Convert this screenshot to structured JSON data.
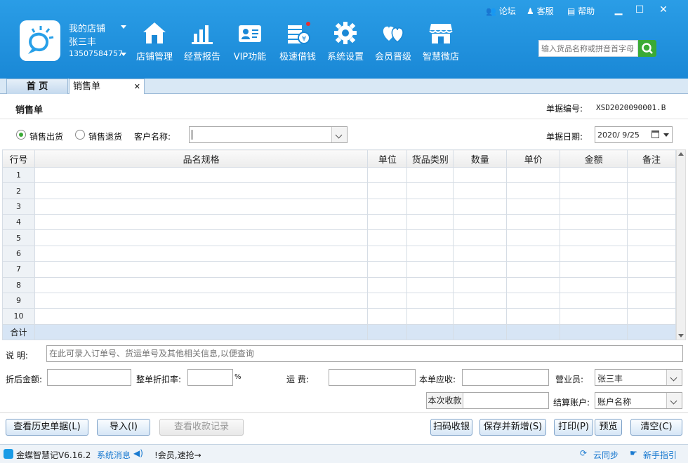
{
  "header": {
    "shop_name": "我的店铺",
    "user_name": "张三丰",
    "phone": "13507584757",
    "top_links": {
      "forum": "论坛",
      "service": "客服",
      "help": "帮助"
    },
    "nav": [
      {
        "label": "店铺管理",
        "icon": "house-icon"
      },
      {
        "label": "经营报告",
        "icon": "bar-chart-icon"
      },
      {
        "label": "VIP功能",
        "icon": "vip-card-icon"
      },
      {
        "label": "极速借钱",
        "icon": "money-stack-icon"
      },
      {
        "label": "系统设置",
        "icon": "gear-icon"
      },
      {
        "label": "会员晋级",
        "icon": "hearts-icon"
      },
      {
        "label": "智慧微店",
        "icon": "store-icon"
      }
    ],
    "search_placeholder": "输入货品名称或拼音首字母"
  },
  "tabs": {
    "home": "首 页",
    "sales": "销售单"
  },
  "form": {
    "title": "销售单",
    "doc_no_label": "单据编号:",
    "doc_no": "XSD2020090001.B",
    "radio_out": "销售出货",
    "radio_return": "销售退货",
    "customer_label": "客户名称:",
    "customer_value": "",
    "date_label": "单据日期:",
    "date_value": "2020/ 9/25"
  },
  "grid": {
    "headers": [
      "行号",
      "品名规格",
      "单位",
      "货品类别",
      "数量",
      "单价",
      "金额",
      "备注"
    ],
    "rows": [
      "1",
      "2",
      "3",
      "4",
      "5",
      "6",
      "7",
      "8",
      "9",
      "10"
    ],
    "total_label": "合计"
  },
  "footer": {
    "note_label": "说  明:",
    "note_placeholder": "在此可录入订单号、货运单号及其他相关信息,以便查询",
    "after_discount_label": "折后金额:",
    "discount_rate_label": "整单折扣率:",
    "percent": "%",
    "freight_label": "运    费:",
    "receivable_label": "本单应收:",
    "salesman_label": "营业员:",
    "salesman_value": "张三丰",
    "received_label": "本次收款",
    "account_label": "结算账户:",
    "account_value": "账户名称"
  },
  "buttons": {
    "history": "查看历史单据(L)",
    "import": "导入(I)",
    "receipts": "查看收款记录",
    "scan": "扫码收银",
    "save_new": "保存并新增(S)",
    "print": "打印(P)",
    "preview": "预览",
    "clear": "清空(C)"
  },
  "status": {
    "app": "金蝶智慧记V6.16.2",
    "msg_label": "系统消息",
    "ticker": "!会员,速抢→",
    "sync": "云同步",
    "guide": "新手指引"
  },
  "colors": {
    "header": "#1a88d6",
    "accent_green": "#3aaa35",
    "total_row": "#d7e5f5"
  }
}
